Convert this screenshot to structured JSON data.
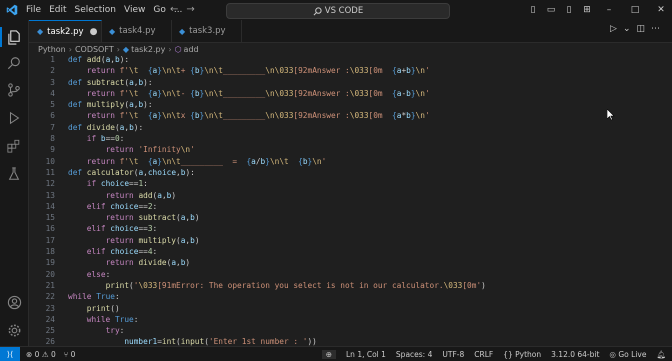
{
  "titlebar": {
    "menu": [
      "File",
      "Edit",
      "Selection",
      "View",
      "Go",
      "..."
    ],
    "search_text": "VS CODE"
  },
  "tabs": [
    {
      "label": "task2.py",
      "active": true,
      "dirty": true
    },
    {
      "label": "task4.py",
      "active": false
    },
    {
      "label": "task3.py",
      "active": false
    }
  ],
  "breadcrumbs": [
    "Python",
    "CODSOFT",
    "task2.py",
    "add"
  ],
  "code_lines": [
    {
      "n": "1",
      "html": "<span class='kwb'>def</span> <span class='fn'>add</span>(<span class='var'>a</span>,<span class='var'>b</span>):"
    },
    {
      "n": "2",
      "html": "    <span class='kw'>return</span> <span class='str'>f'<span class='esc'>\\t</span>  </span><span class='brace'>{</span><span class='var'>a</span><span class='brace'>}</span><span class='str'><span class='esc'>\\n\\t</span>+ </span><span class='brace'>{</span><span class='var'>b</span><span class='brace'>}</span><span class='str'><span class='esc'>\\n\\t</span>_________<span class='esc'>\\n\\033</span>[92mAnswer :<span class='esc'>\\033</span>[0m  </span><span class='brace'>{</span><span class='var'>a</span>+<span class='var'>b</span><span class='brace'>}</span><span class='str'><span class='esc'>\\n</span>'</span>"
    },
    {
      "n": "3",
      "html": "<span class='kwb'>def</span> <span class='fn'>subtract</span>(<span class='var'>a</span>,<span class='var'>b</span>):"
    },
    {
      "n": "4",
      "html": "    <span class='kw'>return</span> <span class='str'>f'<span class='esc'>\\t</span>  </span><span class='brace'>{</span><span class='var'>a</span><span class='brace'>}</span><span class='str'><span class='esc'>\\n\\t</span>- </span><span class='brace'>{</span><span class='var'>b</span><span class='brace'>}</span><span class='str'><span class='esc'>\\n\\t</span>_________<span class='esc'>\\n\\033</span>[92mAnswer :<span class='esc'>\\033</span>[0m  </span><span class='brace'>{</span><span class='var'>a</span>-<span class='var'>b</span><span class='brace'>}</span><span class='str'><span class='esc'>\\n</span>'</span>"
    },
    {
      "n": "5",
      "html": "<span class='kwb'>def</span> <span class='fn'>multiply</span>(<span class='var'>a</span>,<span class='var'>b</span>):"
    },
    {
      "n": "6",
      "html": "    <span class='kw'>return</span> <span class='str'>f'<span class='esc'>\\t</span>  </span><span class='brace'>{</span><span class='var'>a</span><span class='brace'>}</span><span class='str'><span class='esc'>\\n\\t</span>x </span><span class='brace'>{</span><span class='var'>b</span><span class='brace'>}</span><span class='str'><span class='esc'>\\n\\t</span>_________<span class='esc'>\\n\\033</span>[92mAnswer :<span class='esc'>\\033</span>[0m  </span><span class='brace'>{</span><span class='var'>a</span>*<span class='var'>b</span><span class='brace'>}</span><span class='str'><span class='esc'>\\n</span>'</span>"
    },
    {
      "n": "7",
      "html": "<span class='kwb'>def</span> <span class='fn'>divide</span>(<span class='var'>a</span>,<span class='var'>b</span>):"
    },
    {
      "n": "8",
      "html": "    <span class='kw'>if</span> <span class='var'>b</span>==<span class='num'>0</span>:"
    },
    {
      "n": "9",
      "html": "        <span class='kw'>return</span> <span class='str'>'Infinity<span class='esc'>\\n</span>'</span>"
    },
    {
      "n": "10",
      "html": "    <span class='kw'>return</span> <span class='str'>f'<span class='esc'>\\t</span>  </span><span class='brace'>{</span><span class='var'>a</span><span class='brace'>}</span><span class='str'><span class='esc'>\\n\\t</span>_________  =  </span><span class='brace'>{</span><span class='var'>a</span>/<span class='var'>b</span><span class='brace'>}</span><span class='str'><span class='esc'>\\n\\t</span>  </span><span class='brace'>{</span><span class='var'>b</span><span class='brace'>}</span><span class='str'><span class='esc'>\\n</span>'</span>"
    },
    {
      "n": "11",
      "html": "<span class='kwb'>def</span> <span class='fn'>calculator</span>(<span class='var'>a</span>,<span class='var'>choice</span>,<span class='var'>b</span>):"
    },
    {
      "n": "12",
      "html": "    <span class='kw'>if</span> <span class='var'>choice</span>==<span class='num'>1</span>:"
    },
    {
      "n": "13",
      "html": "        <span class='kw'>return</span> <span class='fn'>add</span>(<span class='var'>a</span>,<span class='var'>b</span>)"
    },
    {
      "n": "14",
      "html": "    <span class='kw'>elif</span> <span class='var'>choice</span>==<span class='num'>2</span>:"
    },
    {
      "n": "15",
      "html": "        <span class='kw'>return</span> <span class='fn'>subtract</span>(<span class='var'>a</span>,<span class='var'>b</span>)"
    },
    {
      "n": "16",
      "html": "    <span class='kw'>elif</span> <span class='var'>choice</span>==<span class='num'>3</span>:"
    },
    {
      "n": "17",
      "html": "        <span class='kw'>return</span> <span class='fn'>multiply</span>(<span class='var'>a</span>,<span class='var'>b</span>)"
    },
    {
      "n": "18",
      "html": "    <span class='kw'>elif</span> <span class='var'>choice</span>==<span class='num'>4</span>:"
    },
    {
      "n": "19",
      "html": "        <span class='kw'>return</span> <span class='fn'>divide</span>(<span class='var'>a</span>,<span class='var'>b</span>)"
    },
    {
      "n": "20",
      "html": "    <span class='kw'>else</span>:"
    },
    {
      "n": "21",
      "html": "        <span class='fn'>print</span>(<span class='str'>'<span class='esc'>\\033</span>[91mError: The operation you select is not in our calculator.<span class='esc'>\\033</span>[0m'</span>)"
    },
    {
      "n": "22",
      "html": "<span class='kw'>while</span> <span class='kwb'>True</span>:"
    },
    {
      "n": "23",
      "html": "    <span class='fn'>print</span>()"
    },
    {
      "n": "24",
      "html": "    <span class='kw'>while</span> <span class='kwb'>True</span>:"
    },
    {
      "n": "25",
      "html": "        <span class='kw'>try</span>:"
    },
    {
      "n": "26",
      "html": "            <span class='var'>number1</span>=<span class='fn'>int</span>(<span class='fn'>input</span>(<span class='str'>'Enter 1st number : '</span>))"
    }
  ],
  "statusbar": {
    "remote_icon": "remote-icon",
    "problems": "0",
    "warnings": "0",
    "ports": "0",
    "position": "Ln 1, Col 1",
    "spaces": "Spaces: 4",
    "encoding": "UTF-8",
    "eol": "CRLF",
    "language": "Python",
    "interpreter": "3.12.0 64-bit",
    "golive": "Go Live"
  },
  "colors": {
    "accent": "#0078d4",
    "background": "#1f1f1f"
  }
}
